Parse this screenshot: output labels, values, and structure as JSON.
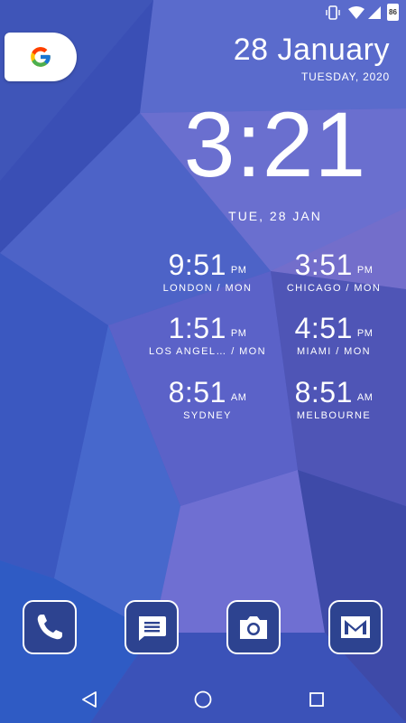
{
  "status_bar": {
    "battery_level": "86",
    "icons": [
      "vibrate-icon",
      "wifi-icon",
      "signal-icon",
      "battery-icon"
    ]
  },
  "search_widget": {
    "icon": "google-g-icon"
  },
  "header": {
    "date": "28 January",
    "day_year": "TUESDAY, 2020"
  },
  "main_clock": {
    "time": "3:21",
    "date": "TUE, 28 JAN"
  },
  "world_clocks": [
    {
      "time": "9:51",
      "ampm": "PM",
      "city": "LONDON / MON"
    },
    {
      "time": "3:51",
      "ampm": "PM",
      "city": "CHICAGO / MON"
    },
    {
      "time": "1:51",
      "ampm": "PM",
      "city": "LOS ANGEL… / MON"
    },
    {
      "time": "4:51",
      "ampm": "PM",
      "city": "MIAMI / MON"
    },
    {
      "time": "8:51",
      "ampm": "AM",
      "city": "SYDNEY"
    },
    {
      "time": "8:51",
      "ampm": "AM",
      "city": "MELBOURNE"
    }
  ],
  "dock": [
    {
      "name": "phone",
      "icon": "phone-icon"
    },
    {
      "name": "messages",
      "icon": "message-icon"
    },
    {
      "name": "camera",
      "icon": "camera-icon"
    },
    {
      "name": "gmail",
      "icon": "gmail-icon"
    }
  ],
  "nav_bar": [
    "back-icon",
    "home-icon",
    "recents-icon"
  ],
  "colors": {
    "accent": "#2d4390",
    "wallpaper_base": "#4a5fc4"
  }
}
